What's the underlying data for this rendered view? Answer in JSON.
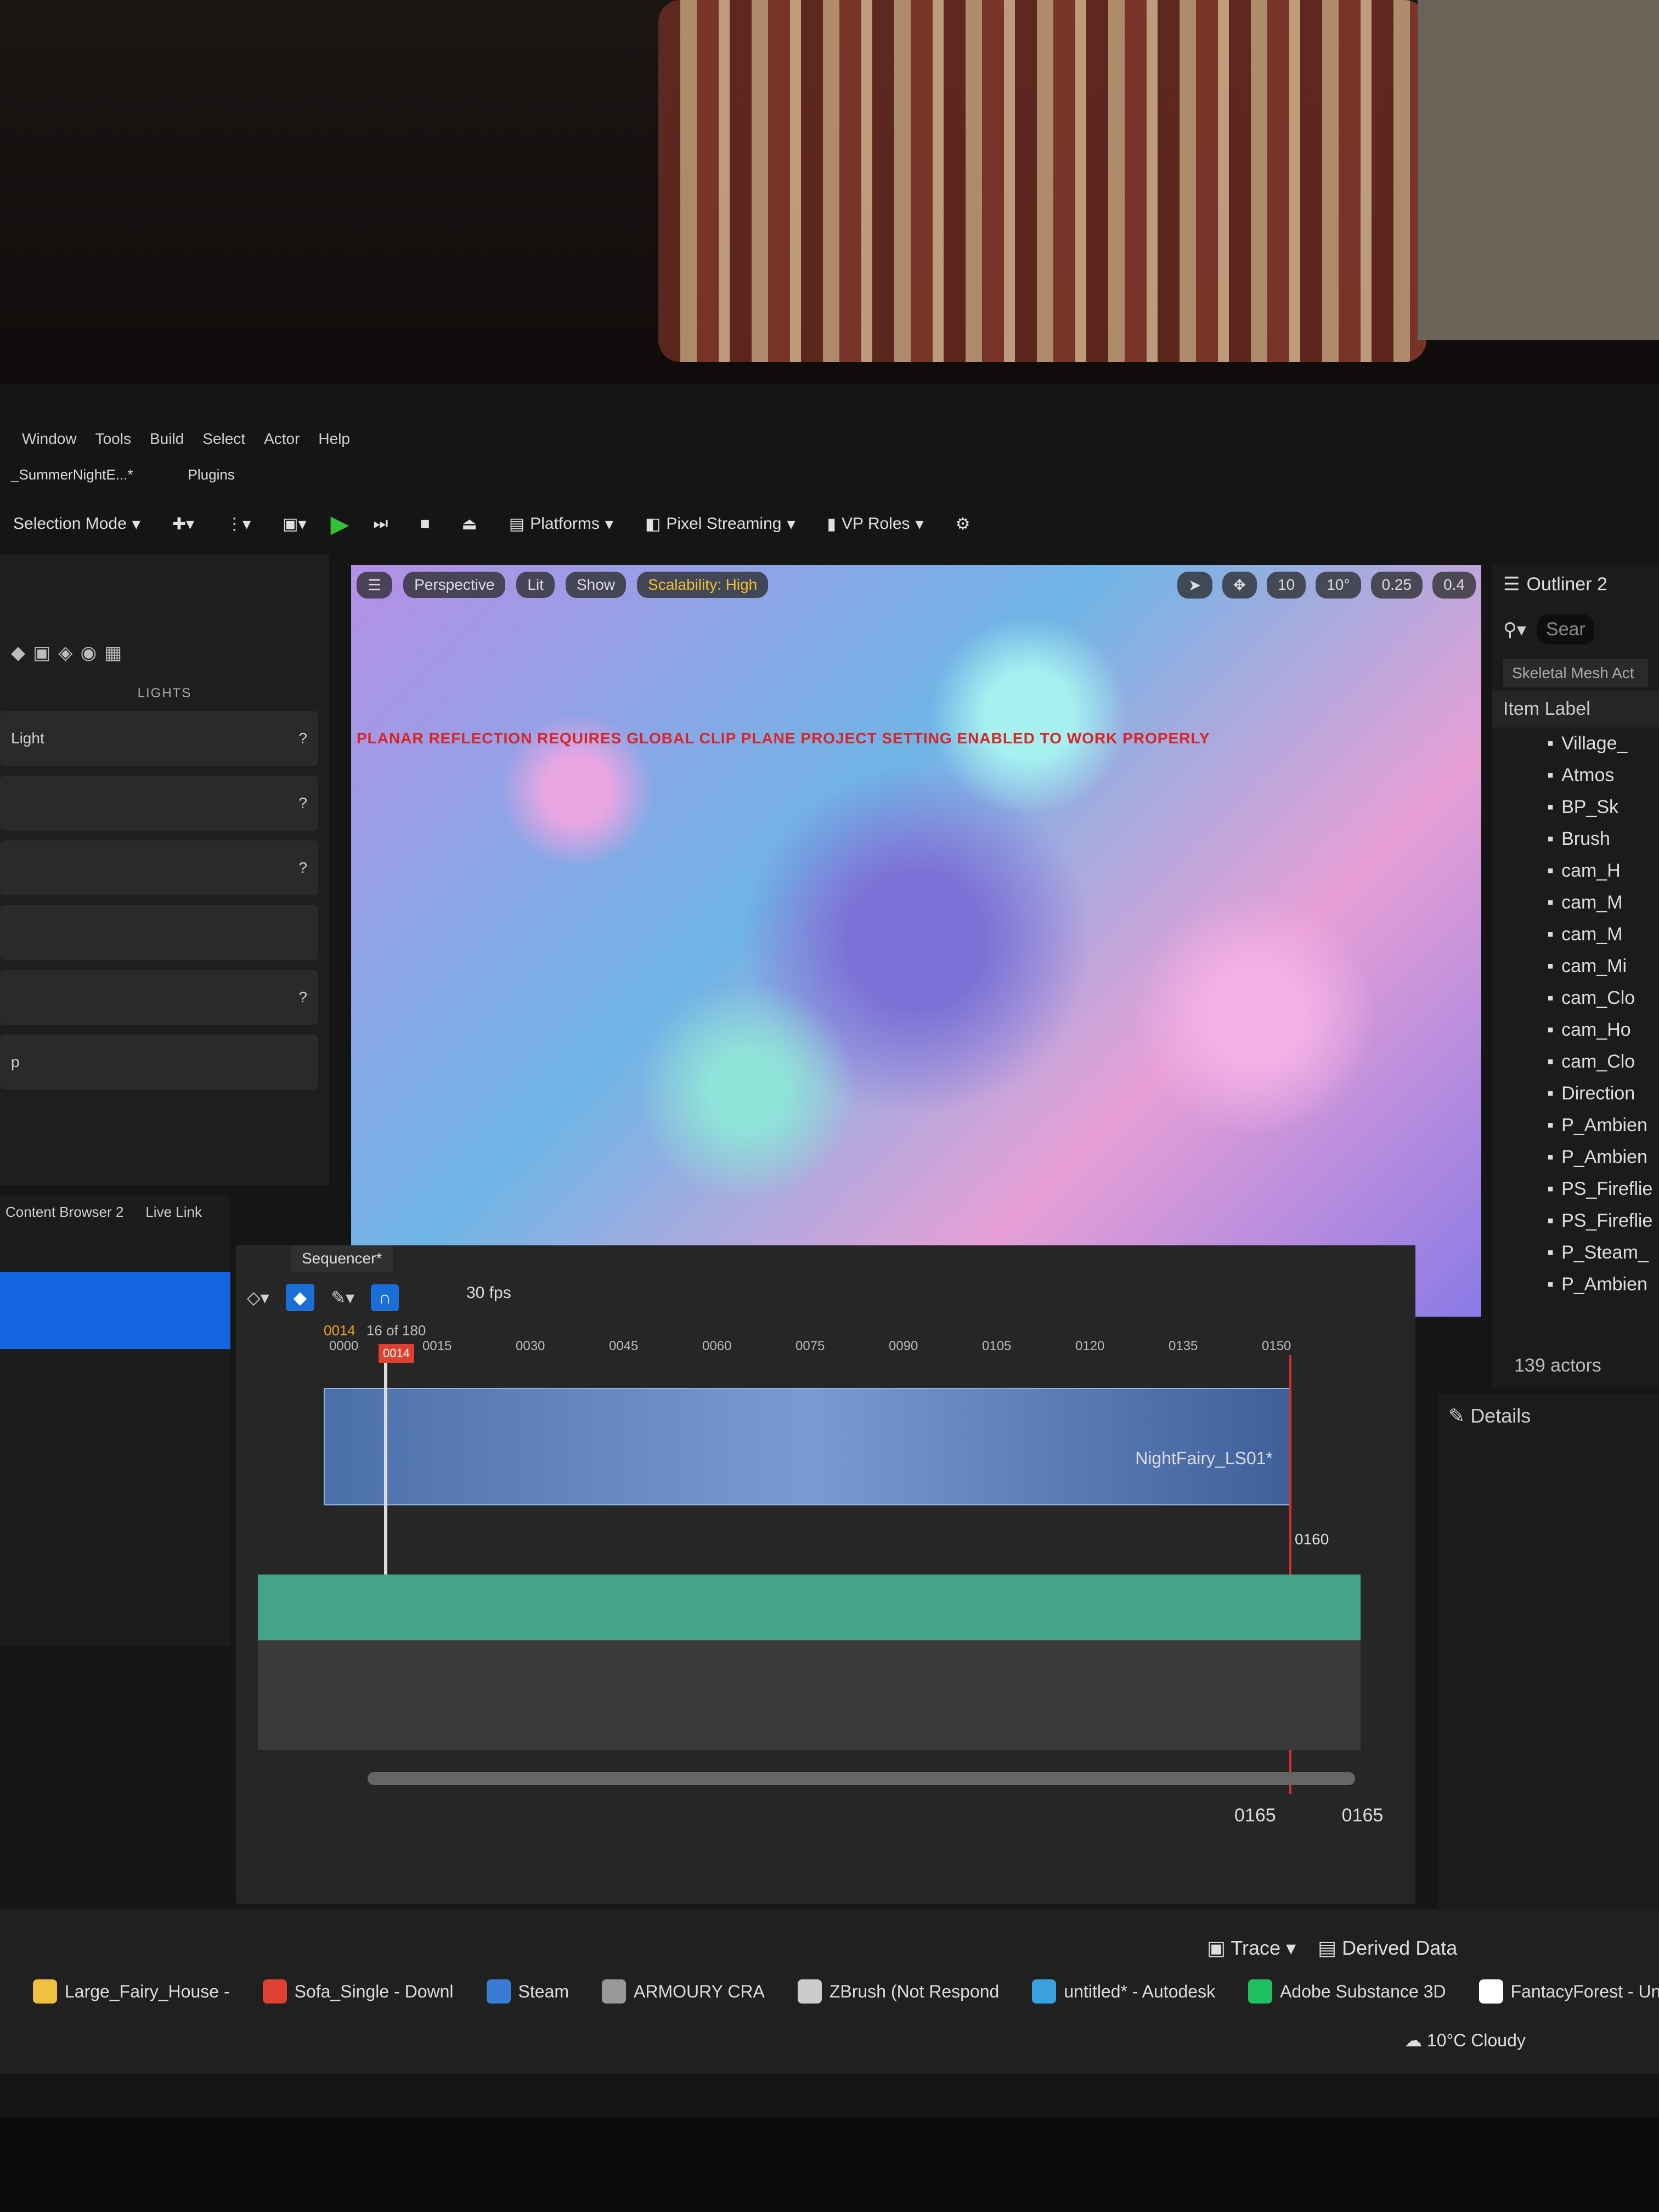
{
  "menu": [
    "Window",
    "Tools",
    "Build",
    "Select",
    "Actor",
    "Help"
  ],
  "tabs": [
    {
      "label": "_SummerNightE...*"
    },
    {
      "label": "Plugins"
    }
  ],
  "toolbar": {
    "selection_mode": "Selection Mode",
    "platforms": "Platforms",
    "pixel_streaming": "Pixel Streaming",
    "vp_roles": "VP Roles"
  },
  "left_panel": {
    "section": "LIGHTS",
    "rows": [
      {
        "label": "Light"
      },
      {
        "label": ""
      },
      {
        "label": ""
      },
      {
        "label": ""
      },
      {
        "label": ""
      },
      {
        "label": "p"
      },
      {
        "label": ""
      }
    ]
  },
  "viewport": {
    "perspective": "Perspective",
    "lit": "Lit",
    "show": "Show",
    "scalability": "Scalability: High",
    "grid": "10",
    "angle": "10°",
    "scale": "0.25",
    "camera_speed": "0.4",
    "warning": "PLANAR REFLECTION REQUIRES GLOBAL CLIP PLANE PROJECT SETTING ENABLED TO WORK PROPERLY"
  },
  "outliner": {
    "title": "Outliner 2",
    "search_placeholder": "Sear",
    "chip": "Skeletal Mesh Act",
    "column": "Item Label",
    "items": [
      "Village_",
      "Atmos",
      "BP_Sk",
      "Brush",
      "cam_H",
      "cam_M",
      "cam_M",
      "cam_Mi",
      "cam_Clo",
      "cam_Ho",
      "cam_Clo",
      "Direction",
      "P_Ambien",
      "P_Ambien",
      "PS_Fireflie",
      "PS_Fireflie",
      "P_Steam_",
      "P_Ambien"
    ],
    "count": "139 actors"
  },
  "details": {
    "title": "Details"
  },
  "content_browser": {
    "tab1": "Content Browser 2",
    "tab2": "Live Link"
  },
  "sequencer": {
    "title": "Sequencer*",
    "fps": "30 fps",
    "current_frame": "0014",
    "frame_count": "16 of 180",
    "ticks": [
      "0000",
      "0015",
      "0030",
      "0045",
      "0060",
      "0075",
      "0090",
      "0105",
      "0120",
      "0135",
      "0150"
    ],
    "playhead": "0014",
    "clip": "NightFairy_LS01*",
    "end_frame": "0160",
    "range_start": "0165",
    "range_end": "0165"
  },
  "taskbar": [
    {
      "label": "Large_Fairy_House -",
      "color": "#f0c040"
    },
    {
      "label": "Sofa_Single - Downl",
      "color": "#e04030"
    },
    {
      "label": "Steam",
      "color": "#3a7bd5"
    },
    {
      "label": "ARMOURY CRA",
      "color": "#999999"
    },
    {
      "label": "ZBrush (Not Respond",
      "color": "#cccccc"
    },
    {
      "label": "untitled* - Autodesk",
      "color": "#3aa0e0"
    },
    {
      "label": "Adobe Substance 3D",
      "color": "#20c060"
    },
    {
      "label": "FantacyForest - Unre",
      "color": "#ffffff"
    }
  ],
  "status": {
    "trace": "Trace",
    "derived_data": "Derived Data"
  },
  "weather": {
    "temp": "10°C",
    "condition": "Cloudy"
  }
}
